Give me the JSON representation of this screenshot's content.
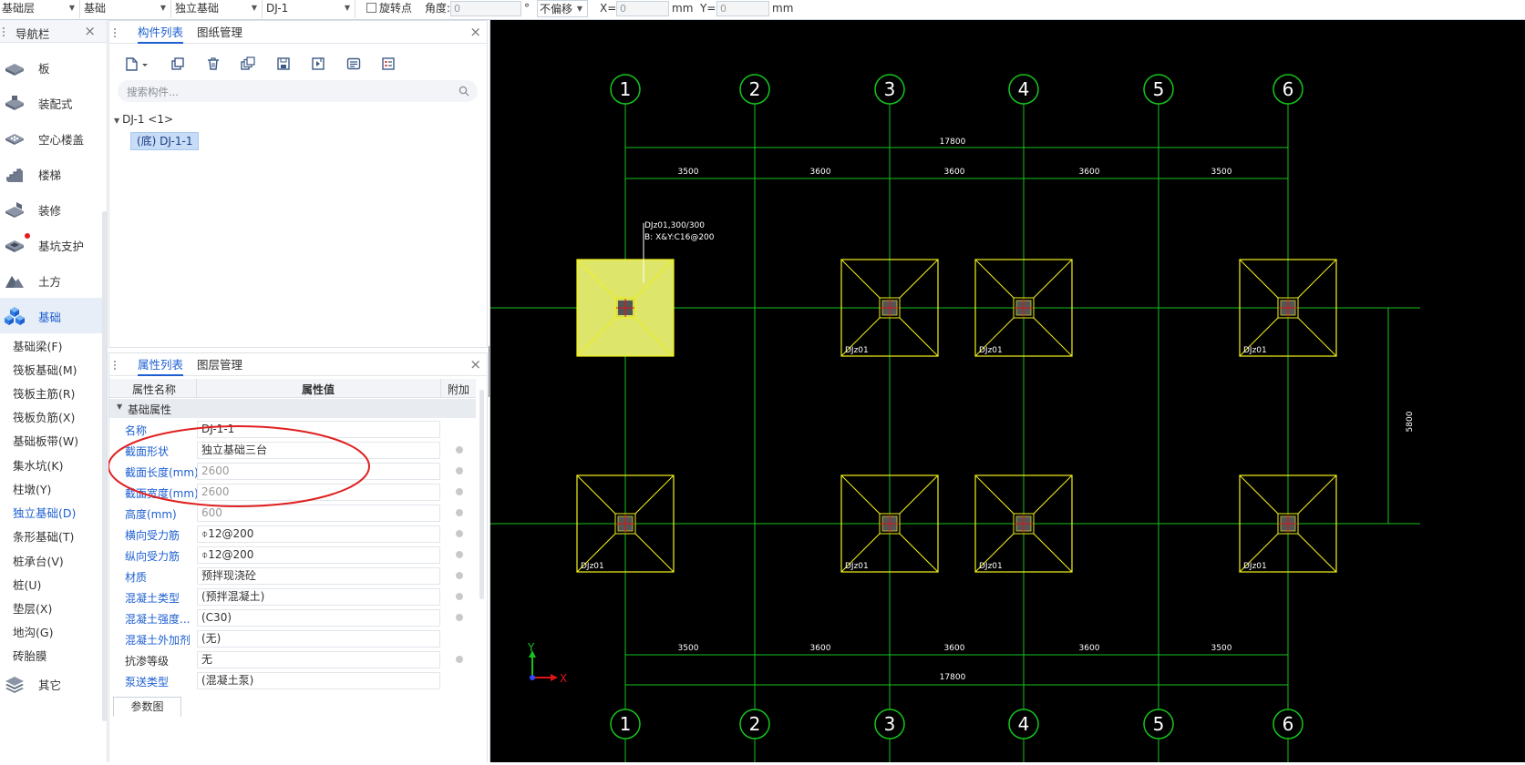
{
  "toolbar": {
    "selects": [
      "基础层",
      "基础",
      "独立基础",
      "DJ-1"
    ],
    "rotate_point_label": "旋转点",
    "angle_label": "角度:",
    "angle_value": "0",
    "degree_symbol": "°",
    "offset_select": "不偏移",
    "x_label": "X=",
    "x_value": "0",
    "y_label": "Y=",
    "y_value": "0",
    "unit": "mm"
  },
  "nav": {
    "title": "导航栏",
    "categories": [
      {
        "label": "板",
        "icon": "slab-icon"
      },
      {
        "label": "装配式",
        "icon": "prefab-icon"
      },
      {
        "label": "空心楼盖",
        "icon": "hollow-floor-icon"
      },
      {
        "label": "楼梯",
        "icon": "stairs-icon"
      },
      {
        "label": "装修",
        "icon": "decoration-icon"
      },
      {
        "label": "基坑支护",
        "icon": "pit-support-icon"
      },
      {
        "label": "土方",
        "icon": "earthwork-icon"
      },
      {
        "label": "基础",
        "icon": "foundation-icon"
      }
    ],
    "sub_items": [
      "基础梁(F)",
      "筏板基础(M)",
      "筏板主筋(R)",
      "筏板负筋(X)",
      "基础板带(W)",
      "集水坑(K)",
      "柱墩(Y)",
      "独立基础(D)",
      "条形基础(T)",
      "桩承台(V)",
      "桩(U)",
      "垫层(X)",
      "地沟(G)",
      "砖胎膜"
    ],
    "other_label": "其它"
  },
  "component_panel": {
    "tabs": [
      "构件列表",
      "图纸管理"
    ],
    "search_placeholder": "搜索构件...",
    "tree_root": "DJ-1 <1>",
    "tree_child": "(底) DJ-1-1"
  },
  "property_panel": {
    "tabs": [
      "属性列表",
      "图层管理"
    ],
    "columns": [
      "属性名称",
      "属性值",
      "附加"
    ],
    "group": "基础属性",
    "rows": [
      {
        "name": "名称",
        "value": "DJ-1-1",
        "gray": false,
        "dot": false,
        "dark": false
      },
      {
        "name": "截面形状",
        "value": "独立基础三台",
        "gray": false,
        "dot": true,
        "dark": false
      },
      {
        "name": "截面长度(mm)",
        "value": "2600",
        "gray": true,
        "dot": true,
        "dark": false
      },
      {
        "name": "截面宽度(mm)",
        "value": "2600",
        "gray": true,
        "dot": true,
        "dark": false
      },
      {
        "name": "高度(mm)",
        "value": "600",
        "gray": true,
        "dot": true,
        "dark": false
      },
      {
        "name": "横向受力筋",
        "value": "⌽12@200",
        "gray": false,
        "dot": true,
        "dark": false
      },
      {
        "name": "纵向受力筋",
        "value": "⌽12@200",
        "gray": false,
        "dot": true,
        "dark": false
      },
      {
        "name": "材质",
        "value": "预拌现浇砼",
        "gray": false,
        "dot": true,
        "dark": false
      },
      {
        "name": "混凝土类型",
        "value": "(预拌混凝土)",
        "gray": false,
        "dot": true,
        "dark": false
      },
      {
        "name": "混凝土强度...",
        "value": "(C30)",
        "gray": false,
        "dot": true,
        "dark": false
      },
      {
        "name": "混凝土外加剂",
        "value": "(无)",
        "gray": false,
        "dot": false,
        "dark": false
      },
      {
        "name": "抗渗等级",
        "value": "无",
        "gray": false,
        "dot": true,
        "dark": true
      },
      {
        "name": "泵送类型",
        "value": "(混凝土泵)",
        "gray": false,
        "dot": false,
        "dark": false
      }
    ],
    "bottom_tab": "参数图"
  },
  "cad": {
    "axis_labels": [
      "1",
      "2",
      "3",
      "4",
      "5",
      "6"
    ],
    "total_dim": "17800",
    "spans": [
      "3500",
      "3600",
      "3600",
      "3600",
      "3500"
    ],
    "vertical_dim": "5800",
    "annotation_line1": "DJz01,300/300",
    "annotation_line2": "B: X&Y:C16@200",
    "footing_label": "DJz01",
    "ucs_x": "X",
    "ucs_y": "Y"
  },
  "colors": {
    "accent": "#1d5fd1",
    "cad_background": "#000000",
    "axis_green": "#16c41d",
    "beam_red": "#e01515",
    "footing_yellow": "#f2f21a",
    "selected_fill": "#dde66a",
    "annotation_red": "#e02020"
  }
}
